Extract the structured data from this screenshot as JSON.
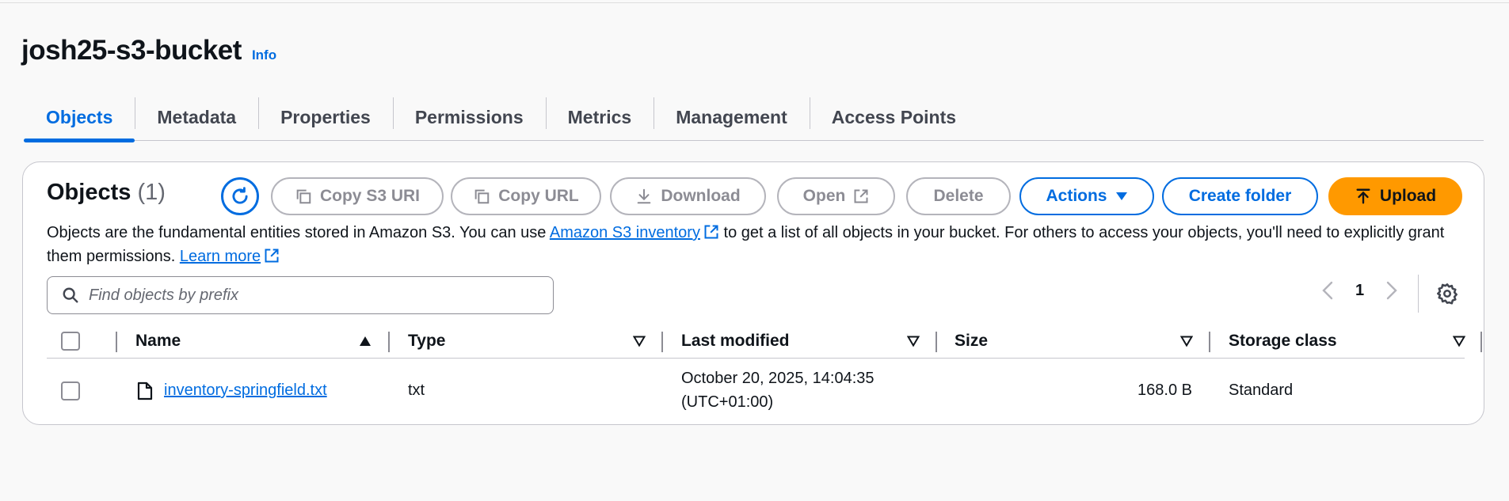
{
  "bucket": {
    "title": "josh25-s3-bucket",
    "info_label": "Info"
  },
  "tabs": [
    {
      "label": "Objects",
      "active": true
    },
    {
      "label": "Metadata"
    },
    {
      "label": "Properties"
    },
    {
      "label": "Permissions"
    },
    {
      "label": "Metrics"
    },
    {
      "label": "Management"
    },
    {
      "label": "Access Points"
    }
  ],
  "objects_panel": {
    "heading": "Objects",
    "count": "(1)",
    "buttons": {
      "copy_s3_uri": "Copy S3 URI",
      "copy_url": "Copy URL",
      "download": "Download",
      "open": "Open",
      "delete": "Delete",
      "actions": "Actions",
      "create_folder": "Create folder",
      "upload": "Upload"
    },
    "description": {
      "part1": "Objects are the fundamental entities stored in Amazon S3. You can use ",
      "inventory_link": "Amazon S3 inventory",
      "part2": " to get a list of all objects in your bucket. For others to access your objects, you'll need to explicitly grant them permissions. ",
      "learn_more": "Learn more"
    },
    "search": {
      "placeholder": "Find objects by prefix",
      "value": ""
    },
    "pagination": {
      "current_page": "1"
    }
  },
  "table": {
    "columns": [
      "Name",
      "Type",
      "Last modified",
      "Size",
      "Storage class"
    ],
    "rows": [
      {
        "name": "inventory-springfield.txt",
        "type": "txt",
        "last_modified_date": "October 20, 2025, 14:04:35",
        "last_modified_tz": "(UTC+01:00)",
        "size": "168.0 B",
        "storage_class": "Standard"
      }
    ]
  },
  "colors": {
    "accent": "#006ce0",
    "upload": "#ff9900",
    "disabled": "#8c8c94"
  }
}
